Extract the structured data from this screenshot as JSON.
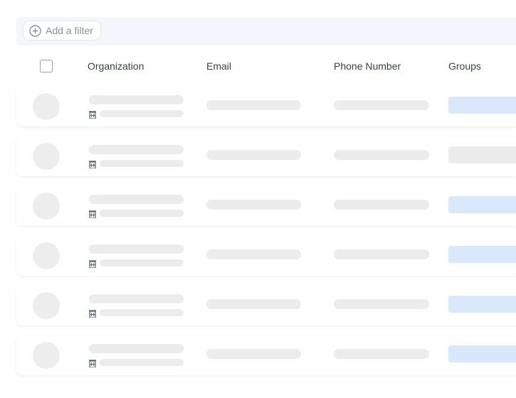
{
  "filter_bar": {
    "add_filter_label": "Add a filter",
    "icon": "plus-circle-icon"
  },
  "table": {
    "columns": [
      "Organization",
      "Email",
      "Phone Number",
      "Groups"
    ],
    "rows_state": "loading-skeleton",
    "row_count": 6,
    "organization_icon": "building-icon",
    "group_placeholder_colors": [
      "#d9e8fb",
      "#ececec",
      "#d9e8fb",
      "#d9e8fb",
      "#d9e8fb",
      "#d9e8fb"
    ]
  },
  "colors": {
    "filter_bar_bg": "#f3f7fd",
    "skeleton_gray": "#ececec",
    "skeleton_blue": "#d9e8fb",
    "text": "#3a3f4b",
    "muted_text": "#8a909c"
  }
}
